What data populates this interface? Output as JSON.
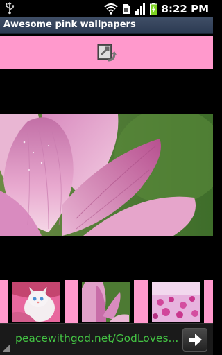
{
  "status_bar": {
    "time": "8:22 PM",
    "icons": [
      "usb-icon",
      "wifi-icon",
      "sim-card-icon",
      "signal-icon",
      "battery-charging-icon"
    ]
  },
  "app": {
    "title": "Awesome pink wallpapers"
  },
  "toolbar": {
    "set_wallpaper_icon": "set-wallpaper-icon"
  },
  "main_image": {
    "subject": "pink-lotus-flower"
  },
  "gallery": {
    "thumbnails": [
      {
        "subject": "white-kitten-pink-background"
      },
      {
        "subject": "pink-lotus-flower"
      },
      {
        "subject": "pink-flower-field"
      }
    ]
  },
  "ad": {
    "text": "peacewithgod.net/GodLoves...",
    "arrow_icon": "right-arrow-icon"
  },
  "colors": {
    "pink": "#ff99cc",
    "title_bar": "#34435b",
    "ad_text": "#43c243"
  }
}
